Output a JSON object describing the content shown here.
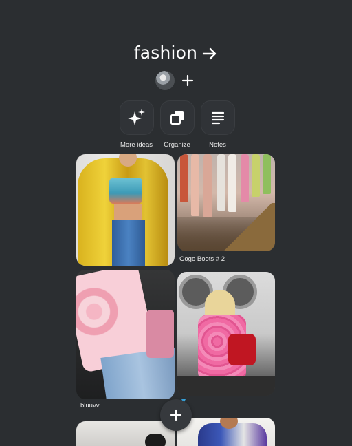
{
  "board": {
    "title": "fashion"
  },
  "actions": [
    {
      "label": "More ideas",
      "icon": "sparkle-icon"
    },
    {
      "label": "Organize",
      "icon": "organize-icon"
    },
    {
      "label": "Notes",
      "icon": "notes-icon"
    }
  ],
  "pins": [
    {
      "caption": ""
    },
    {
      "caption": "Gogo Boots # 2"
    },
    {
      "caption": "bluuvv"
    },
    {
      "caption": ""
    }
  ],
  "colors": {
    "background": "#2b2e31",
    "button_bg": "#303337",
    "text": "#ffffff"
  }
}
